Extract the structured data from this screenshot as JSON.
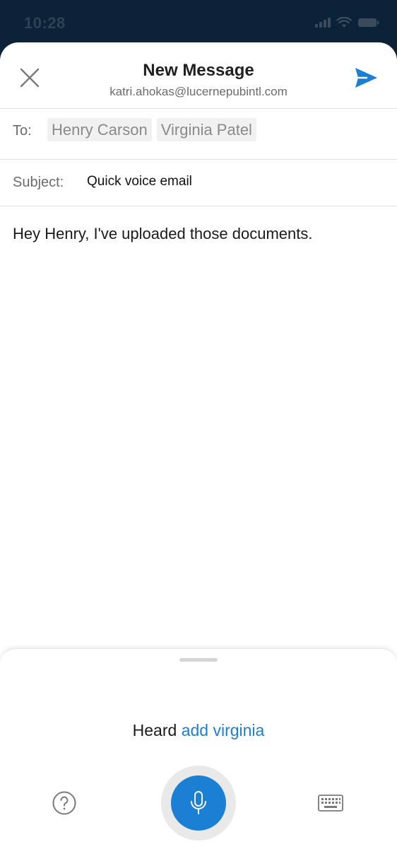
{
  "status_bar": {
    "time": "10:28",
    "icons": [
      "signal-icon",
      "wifi-icon",
      "battery-icon"
    ]
  },
  "compose": {
    "title": "New Message",
    "account": "katri.ahokas@lucernepubintl.com",
    "to_label": "To:",
    "recipients": [
      "Henry Carson",
      "Virginia Patel"
    ],
    "subject_label": "Subject:",
    "subject_value": "Quick voice email",
    "body": "Hey Henry, I've uploaded those documents."
  },
  "voice": {
    "heard_prefix": "Heard",
    "heard_command": "add virginia"
  },
  "colors": {
    "accent": "#1b7fd4",
    "status_bar_bg": "#0b2239"
  }
}
